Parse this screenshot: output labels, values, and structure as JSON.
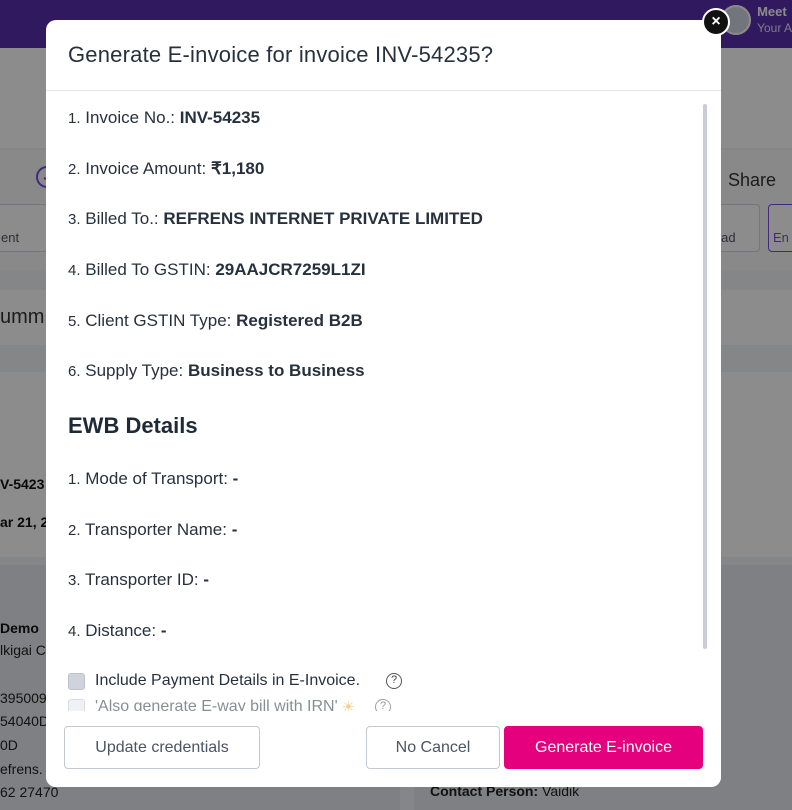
{
  "background": {
    "user_name": "Meet",
    "user_sub": "Your A",
    "share_label": "Share",
    "btn_left_partial": "ent",
    "btn_right_partial": "load",
    "btn_right2_partial": "En",
    "summary_partial": "umm",
    "invoice_partial": "V-5423",
    "date_partial": "ar 21, 20",
    "client_partial": "Demo",
    "address_partial": "lkigai C",
    "line1_partial": "395009",
    "line2_partial": "54040D",
    "line3_partial": "0D",
    "line4_partial": "efrens.",
    "line5_partial": "62 27470",
    "contact_label": "Contact Person:",
    "contact_value": "Vaidik"
  },
  "modal": {
    "title": "Generate E-invoice for invoice INV-54235?",
    "details": [
      {
        "index": "1.",
        "label": "Invoice No.:",
        "value": "INV-54235"
      },
      {
        "index": "2.",
        "label": "Invoice Amount:",
        "value": "₹1,180"
      },
      {
        "index": "3.",
        "label": "Billed To.:",
        "value": "REFRENS INTERNET PRIVATE LIMITED"
      },
      {
        "index": "4.",
        "label": "Billed To GSTIN:",
        "value": "29AAJCR7259L1ZI"
      },
      {
        "index": "5.",
        "label": "Client GSTIN Type:",
        "value": "Registered B2B"
      },
      {
        "index": "6.",
        "label": "Supply Type:",
        "value": "Business to Business"
      }
    ],
    "ewb_title": "EWB Details",
    "ewb_details": [
      {
        "index": "1.",
        "label": "Mode of Transport:",
        "value": "-"
      },
      {
        "index": "2.",
        "label": "Transporter Name:",
        "value": "-"
      },
      {
        "index": "3.",
        "label": "Transporter ID:",
        "value": "-"
      },
      {
        "index": "4.",
        "label": "Distance:",
        "value": "-"
      }
    ],
    "checkbox_payment": "Include Payment Details in E-Invoice.",
    "checkbox_ewaybill": "'Also generate E-way bill with IRN'",
    "help_glyph": "?",
    "close_glyph": "×",
    "buttons": {
      "update": "Update credentials",
      "cancel": "No Cancel",
      "generate": "Generate E-invoice"
    },
    "colors": {
      "primary": "#e5007d",
      "topbar": "#5a2fb0"
    }
  }
}
